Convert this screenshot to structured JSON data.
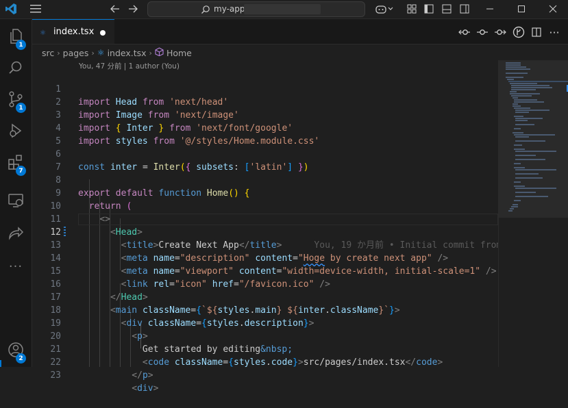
{
  "titlebar": {
    "search_label": "my-app",
    "icons": [
      "vscode-logo-icon",
      "hamburger-menu-icon",
      "back-arrow-icon",
      "forward-arrow-icon",
      "copilot-icon",
      "customize-layout-icon",
      "toggle-primary-sidebar-icon",
      "toggle-panel-icon",
      "toggle-secondary-sidebar-icon",
      "minimize-icon",
      "maximize-icon",
      "close-icon"
    ]
  },
  "activity_bar": {
    "items": [
      {
        "name": "explorer",
        "icon": "files-icon",
        "badge": "1"
      },
      {
        "name": "search",
        "icon": "search-icon",
        "badge": ""
      },
      {
        "name": "source-control",
        "icon": "source-control-icon",
        "badge": "1"
      },
      {
        "name": "run-debug",
        "icon": "debug-icon",
        "badge": ""
      },
      {
        "name": "extensions",
        "icon": "extensions-icon",
        "badge": "7"
      },
      {
        "name": "remote-explorer",
        "icon": "remote-explorer-icon",
        "badge": ""
      },
      {
        "name": "live-share",
        "icon": "live-share-icon",
        "badge": ""
      },
      {
        "name": "more",
        "icon": "more-icon",
        "badge": ""
      },
      {
        "name": "accounts",
        "icon": "account-icon",
        "badge": "2"
      }
    ]
  },
  "tab": {
    "name": "index.tsx",
    "icon_text": "⚛"
  },
  "breadcrumb": {
    "parts": [
      "src",
      "pages",
      "index.tsx",
      "Home"
    ]
  },
  "blame_header": "You, 47 分前 | 1 author (You)",
  "current_line_blame": "You, 19 か月前 • Initial commit from",
  "current_line": 12,
  "line_numbers": [
    "1",
    "2",
    "3",
    "4",
    "5",
    "6",
    "7",
    "8",
    "9",
    "10",
    "11",
    "12",
    "13",
    "14",
    "15",
    "16",
    "17",
    "18",
    "19",
    "20",
    "21",
    "22",
    "23"
  ],
  "code": {
    "l1": [
      "import",
      "Head",
      "from",
      "'next/head'"
    ],
    "l2": [
      "import",
      "Image",
      "from",
      "'next/image'"
    ],
    "l3": [
      "import",
      "{",
      "Inter",
      "}",
      "from",
      "'next/font/google'"
    ],
    "l4": [
      "import",
      "styles",
      "from",
      "'@/styles/Home.module.css'"
    ],
    "l6": [
      "const",
      "inter",
      "=",
      "Inter",
      "(",
      "{",
      "subsets",
      ":",
      "[",
      "'latin'",
      "]",
      "}",
      ")"
    ],
    "l8": [
      "export",
      "default",
      "function",
      "Home",
      "()",
      "{"
    ],
    "l9": [
      "return",
      "("
    ],
    "l10": [
      "<>"
    ],
    "l11": [
      "<",
      "Head",
      ">"
    ],
    "l12": [
      "<",
      "title",
      ">",
      "Create Next App",
      "</",
      "title",
      ">"
    ],
    "l13": [
      "<",
      "meta",
      "name",
      "=",
      "\"description\"",
      "content",
      "=",
      "\"",
      "Hoge",
      " by create next app\"",
      "/>"
    ],
    "l14": [
      "<",
      "meta",
      "name",
      "=",
      "\"viewport\"",
      "content",
      "=",
      "\"width=device-width, initial-scale=1\"",
      "/>"
    ],
    "l15": [
      "<",
      "link",
      "rel",
      "=",
      "\"icon\"",
      "href",
      "=",
      "\"/favicon.ico\"",
      "/>"
    ],
    "l16": [
      "</",
      "Head",
      ">"
    ],
    "l17": [
      "<",
      "main",
      "className",
      "=",
      "{",
      "`${",
      "styles",
      ".",
      "main",
      "}",
      " ${",
      "inter",
      ".",
      "className",
      "}`",
      "}",
      ">"
    ],
    "l18": [
      "<",
      "div",
      "className",
      "=",
      "{",
      "styles",
      ".",
      "description",
      "}",
      ">"
    ],
    "l19": [
      "<",
      "p",
      ">"
    ],
    "l20": [
      "Get started by editing",
      "&nbsp;"
    ],
    "l21": [
      "<",
      "code",
      "className",
      "=",
      "{",
      "styles",
      ".",
      "code",
      "}",
      ">",
      "src/pages/index.tsx",
      "</",
      "code",
      ">"
    ],
    "l22": [
      "</",
      "p",
      ">"
    ],
    "l23": [
      "<",
      "div",
      ">"
    ]
  }
}
